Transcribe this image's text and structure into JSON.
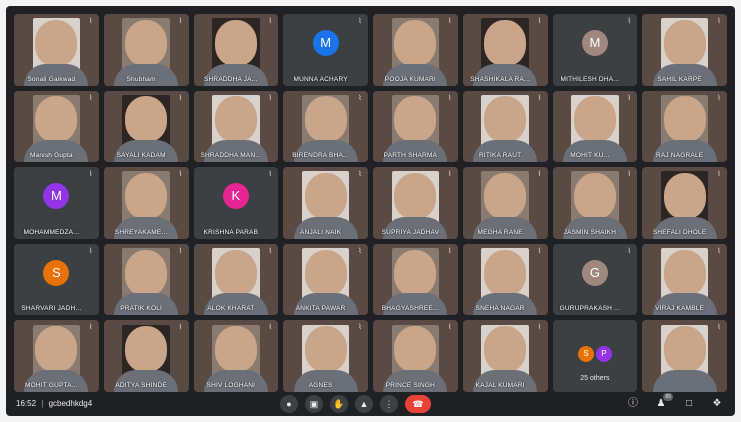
{
  "participants": [
    {
      "name": "Sonali Gaikwad",
      "type": "video",
      "tone": "light"
    },
    {
      "name": "Shubham",
      "type": "video",
      "tone": ""
    },
    {
      "name": "SHRADDHA JA...",
      "type": "video",
      "tone": "dark"
    },
    {
      "name": "MUNNA ACHARY",
      "type": "avatar",
      "initial": "M",
      "color": "#1a73e8"
    },
    {
      "name": "POOJA KUMARI",
      "type": "video",
      "tone": ""
    },
    {
      "name": "SHASHIKALA RA...",
      "type": "video",
      "tone": "dark"
    },
    {
      "name": "MITHILESH DHA...",
      "type": "avatar",
      "initial": "M",
      "color": "#a1887f"
    },
    {
      "name": "SAHIL KARPE",
      "type": "video",
      "tone": "light"
    },
    {
      "name": "Manish Gupta",
      "type": "video",
      "tone": ""
    },
    {
      "name": "SAYALI KADAM",
      "type": "video",
      "tone": "dark"
    },
    {
      "name": "SHRADDHA MAN...",
      "type": "video",
      "tone": "light"
    },
    {
      "name": "BIRENDRA BHA...",
      "type": "video",
      "tone": ""
    },
    {
      "name": "PARTH SHARMA",
      "type": "video",
      "tone": ""
    },
    {
      "name": "RITIKA RAUT",
      "type": "video",
      "tone": "light"
    },
    {
      "name": "MOHIT KU...",
      "type": "video",
      "tone": "light"
    },
    {
      "name": "RAJ NAGRALE",
      "type": "video",
      "tone": ""
    },
    {
      "name": "MOHAMMEDZA...",
      "type": "avatar",
      "initial": "M",
      "color": "#9334e6"
    },
    {
      "name": "SHREYAKAME...",
      "type": "video",
      "tone": ""
    },
    {
      "name": "KRISHNA PARAB",
      "type": "avatar",
      "initial": "K",
      "color": "#e52592"
    },
    {
      "name": "ANJALI NAIK",
      "type": "video",
      "tone": "light"
    },
    {
      "name": "SUPRIYA JADHAV",
      "type": "video",
      "tone": "light"
    },
    {
      "name": "MEGHA RANE",
      "type": "video",
      "tone": ""
    },
    {
      "name": "JASMIN SHAIKH",
      "type": "video",
      "tone": ""
    },
    {
      "name": "SHEFALI DHOLE",
      "type": "video",
      "tone": "dark"
    },
    {
      "name": "SHARVARI JADH...",
      "type": "avatar",
      "initial": "S",
      "color": "#e8710a"
    },
    {
      "name": "PRATIK KOLI",
      "type": "video",
      "tone": ""
    },
    {
      "name": "ALOK KHARAT",
      "type": "video",
      "tone": "light"
    },
    {
      "name": "ANKITA PAWAR",
      "type": "video",
      "tone": "light"
    },
    {
      "name": "BHAGYASHREE...",
      "type": "video",
      "tone": ""
    },
    {
      "name": "SNEHA NAGAR",
      "type": "video",
      "tone": "light"
    },
    {
      "name": "GURUPRAKASH ...",
      "type": "avatar",
      "initial": "G",
      "color": "#a1887f"
    },
    {
      "name": "VIRAJ KAMBLE",
      "type": "video",
      "tone": "light"
    },
    {
      "name": "MOHIT GUPTA...",
      "type": "video",
      "tone": ""
    },
    {
      "name": "ADITYA SHINDE",
      "type": "video",
      "tone": "dark"
    },
    {
      "name": "SHIV LOGHANI",
      "type": "video",
      "tone": ""
    },
    {
      "name": "AGNES",
      "type": "video",
      "tone": "light"
    },
    {
      "name": "PRINCE SINGH",
      "type": "video",
      "tone": ""
    },
    {
      "name": "KAJAL KUMARI",
      "type": "video",
      "tone": "light"
    },
    {
      "name": "",
      "type": "others",
      "label": "25 others",
      "initials": [
        "S",
        "P"
      ],
      "colors": [
        "#e8710a",
        "#9334e6"
      ]
    },
    {
      "name": "",
      "type": "video",
      "tone": "light"
    }
  ],
  "toolbar": {
    "time": "16:52",
    "separator": "|",
    "meeting_code": "gcbedhkdg4",
    "mic_icon": "mic-icon",
    "camera_icon": "camera-icon",
    "raise_hand_icon": "raise-hand-icon",
    "present_icon": "present-icon",
    "more_icon": "more-options-icon",
    "end_call_icon": "end-call-icon",
    "info_icon": "info-icon",
    "people_icon": "people-icon",
    "people_count": "65",
    "chat_icon": "chat-icon",
    "activities_icon": "activities-icon"
  }
}
